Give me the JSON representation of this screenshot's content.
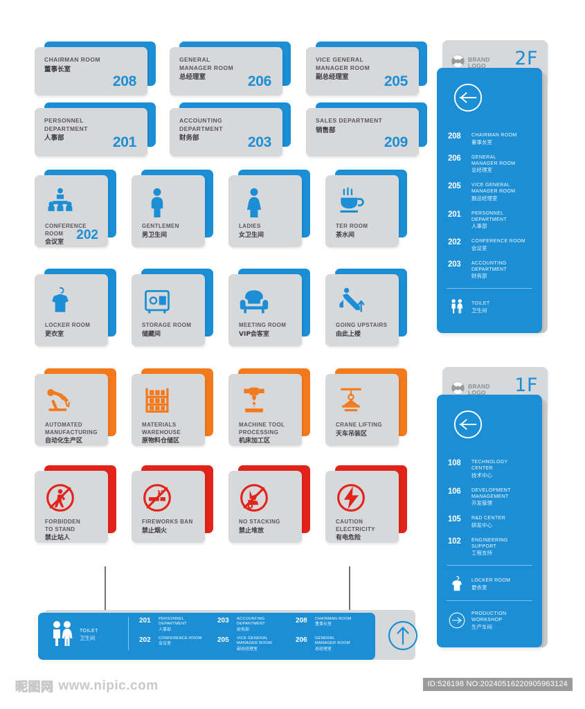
{
  "colors": {
    "blue": "#1b8ed6",
    "orange": "#f2791c",
    "red": "#e2231a",
    "grey_face": "#d7d8d9"
  },
  "room_plates": [
    {
      "en": "CHAIRMAN ROOM",
      "cn": "董事长室",
      "no": "208"
    },
    {
      "en": "GENERAL\nMANAGER ROOM",
      "cn": "总经理室",
      "no": "206"
    },
    {
      "en": "VICE GENERAL\nMANAGER ROOM",
      "cn": "副总经理室",
      "no": "205"
    },
    {
      "en": "PERSONNEL\nDEPARTMENT",
      "cn": "人事部",
      "no": "201"
    },
    {
      "en": "ACCOUNTING\nDEPARTMENT",
      "cn": "财务部",
      "no": "203"
    },
    {
      "en": "SALES  DEPARTMENT",
      "cn": "销售部",
      "no": "209"
    }
  ],
  "icon_plates": [
    {
      "icon": "conference-people-icon",
      "en": "CONFERENCE\nROOM",
      "cn": "会议室",
      "no": "202",
      "accent": "#1b8ed6"
    },
    {
      "icon": "man-icon",
      "en": "GENTLEMEN",
      "cn": "男卫生间",
      "no": "",
      "accent": "#1b8ed6"
    },
    {
      "icon": "woman-icon",
      "en": "LADIES",
      "cn": "女卫生间",
      "no": "",
      "accent": "#1b8ed6"
    },
    {
      "icon": "tea-cup-icon",
      "en": "TER ROOM",
      "cn": "茶水间",
      "no": "",
      "accent": "#1b8ed6"
    },
    {
      "icon": "locker-shirt-icon",
      "en": "LOCKER ROOM",
      "cn": "更衣室",
      "no": "",
      "accent": "#1b8ed6"
    },
    {
      "icon": "safe-box-icon",
      "en": "STORAGE ROOM",
      "cn": "储藏间",
      "no": "",
      "accent": "#1b8ed6"
    },
    {
      "icon": "armchair-icon",
      "en": "MEETING ROOM",
      "cn": "VIP会客室",
      "no": "",
      "accent": "#1b8ed6"
    },
    {
      "icon": "escalator-up-icon",
      "en": "GOING UPSTAIRS",
      "cn": "由此上楼",
      "no": "",
      "accent": "#1b8ed6"
    },
    {
      "icon": "robot-arm-icon",
      "en": "AUTOMATED\nMANUFACTURING",
      "cn": "自动化生产区",
      "no": "",
      "accent": "#f2791c"
    },
    {
      "icon": "warehouse-rack-icon",
      "en": "MATERIALS\nWAREHOUSE",
      "cn": "原物料仓储区",
      "no": "",
      "accent": "#f2791c"
    },
    {
      "icon": "machine-tool-icon",
      "en": "MACHINE TOOL\nPROCESSING",
      "cn": "机床加工区",
      "no": "",
      "accent": "#f2791c"
    },
    {
      "icon": "crane-icon",
      "en": "CRANE LIFTING",
      "cn": "天车吊装区",
      "no": "",
      "accent": "#f2791c"
    },
    {
      "icon": "no-standing-icon",
      "en": "FORBIDDEN\nTO STAND",
      "cn": "禁止站人",
      "no": "",
      "accent": "#e2231a"
    },
    {
      "icon": "no-fireworks-icon",
      "en": "FIREWORKS BAN",
      "cn": "禁止烟火",
      "no": "",
      "accent": "#e2231a"
    },
    {
      "icon": "no-stacking-icon",
      "en": "NO STACKING",
      "cn": "禁止堆放",
      "no": "",
      "accent": "#e2231a"
    },
    {
      "icon": "electricity-hazard-icon",
      "en": "CAUTION\nELECTRICITY",
      "cn": "有电危险",
      "no": "",
      "accent": "#e2231a"
    }
  ],
  "tower_2f": {
    "brand_line1": "BRAND",
    "brand_line2": "LOGO",
    "floor": "2F",
    "back_arrow_icon": "arrow-left-circle-icon",
    "rooms": [
      {
        "no": "208",
        "en": "CHAIRMAN ROOM",
        "cn": "董事长室"
      },
      {
        "no": "206",
        "en": "GENERAL\nMANAGER ROOM",
        "cn": "总经理室"
      },
      {
        "no": "205",
        "en": "VICE GENERAL\nMANAGER ROOM",
        "cn": "副总经理室"
      },
      {
        "no": "201",
        "en": "PERSONNEL\nDEPARTMENT",
        "cn": "人事部"
      },
      {
        "no": "202",
        "en": "CONFERENCE ROOM",
        "cn": "会议室"
      },
      {
        "no": "203",
        "en": "ACCOUNTING\nDEPARTMENT",
        "cn": "财务部"
      }
    ],
    "extras": [
      {
        "icon": "toilet-pair-icon",
        "en": "TOILET",
        "cn": "卫生间"
      }
    ]
  },
  "tower_1f": {
    "brand_line1": "BRAND",
    "brand_line2": "LOGO",
    "floor": "1F",
    "back_arrow_icon": "arrow-left-circle-icon",
    "rooms": [
      {
        "no": "108",
        "en": "TECHNOLOGY\nCENTER",
        "cn": "技术中心"
      },
      {
        "no": "106",
        "en": "DEVELOPMENT\nMANAGEMENT",
        "cn": "开发管理"
      },
      {
        "no": "105",
        "en": "R&D CENTER",
        "cn": "研发中心"
      },
      {
        "no": "102",
        "en": "ENGINEERING\nSUPPORT",
        "cn": "工程支持"
      }
    ],
    "extras": [
      {
        "icon": "locker-shirt-icon",
        "en": "LOCKER ROOM",
        "cn": "更衣室"
      },
      {
        "icon": "arrow-right-circle-icon",
        "en": "PRODUCTION\nWORKSHOP",
        "cn": "生产车间"
      }
    ]
  },
  "hanging_sign": {
    "toilet": {
      "icon": "toilet-pair-icon",
      "en": "TOILET",
      "cn": "卫生间"
    },
    "up_arrow_icon": "arrow-up-circle-icon",
    "entries": [
      {
        "no": "201",
        "en": "PERSONNEL\nDEPARTMENT",
        "cn": "人事部"
      },
      {
        "no": "203",
        "en": "ACCOUNTING\nDEPARTMENT",
        "cn": "财务部"
      },
      {
        "no": "208",
        "en": "CHAIRMAN ROOM",
        "cn": "董事长室"
      },
      {
        "no": "202",
        "en": "CONFERENCE ROOM",
        "cn": "会议室"
      },
      {
        "no": "205",
        "en": "VICE GENERAL\nMANAGER ROOM",
        "cn": "副总经理室"
      },
      {
        "no": "206",
        "en": "GENERAL\nMANAGER ROOM",
        "cn": "总经理室"
      }
    ]
  },
  "footer": {
    "watermark_cn": "昵图网",
    "watermark_url": "www.nipic.com",
    "id_text": "ID:526198 NO:20240516220905963124"
  }
}
